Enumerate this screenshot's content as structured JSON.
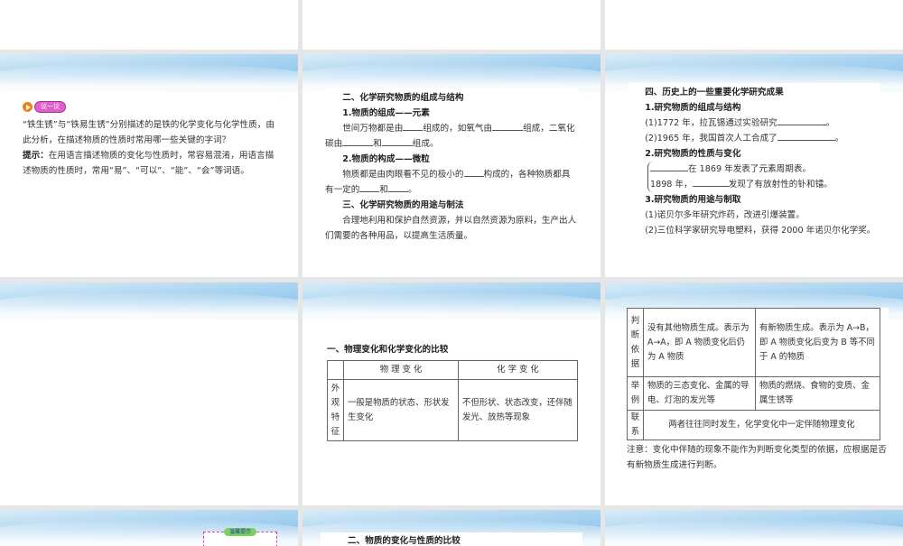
{
  "slides": {
    "s4": {
      "badge": "议一议",
      "question": "“铁生锈”与“铁易生锈”分别描述的是铁的化学变化与化学性质，由此分析，在描述物质的性质时常用哪一些关键的字词？",
      "hint_label": "提示：",
      "hint": "在用语言描述物质的变化与性质时，常容易混淆，用语言描述物质的性质时，常用“易”、“可以”、“能”、“会”等词语。"
    },
    "s5": {
      "h1": "二、化学研究物质的组成与结构",
      "h1_1": "1.物质的组成——元素",
      "p1a": "世间万物都是由",
      "p1b": "组成的，如氧气由",
      "p1c": "组成，二氧化碳由",
      "p1d": "和",
      "p1e": "组成。",
      "h1_2": "2.物质的构成——微粒",
      "p2a": "物质都是由肉眼看不见的极小的",
      "p2b": "构成的，各种物质都具有一定的",
      "p2c": "和",
      "p2d": "。",
      "h2": "三、化学研究物质的用途与制法",
      "p3": "合理地利用和保护自然资源，并以自然资源为原料，生产出人们需要的各种用品，以提高生活质量。"
    },
    "s6": {
      "h": "四、历史上的一些重要化学研究成果",
      "h1": "1.研究物质的组成与结构",
      "l1": "(1)1772 年，拉瓦锡通过实验研究",
      "l2": "(2)1965 年，我国首次人工合成了",
      "end": "。",
      "h2": "2.研究物质的性质与变化",
      "b1": "在 1869 年发表了元素周期表。",
      "b2a": "1898 年，",
      "b2b": "发现了有放射性的钋和镭。",
      "h3": "3.研究物质的用途与制取",
      "l3": "(1)诺贝尔多年研究炸药，改进引爆装置。",
      "l4": "(2)三位科学家研究导电塑料，获得 2000 年诺贝尔化学奖。"
    },
    "s8": {
      "title": "一、物理变化和化学变化的比较",
      "col1": "物 理 变 化",
      "col2": "化 学 变 化",
      "row_label": "外观特征",
      "phys": "一般是物质的状态、形状发生变化",
      "chem": "不但形状、状态改变，还伴随发光、放热等现象"
    },
    "s9": {
      "r1_label": "判断依据",
      "r1_phys": "没有其他物质生成。表示为 A→A，即 A 物质变化后仍为 A 物质",
      "r1_chem": "有新物质生成。表示为 A→B，即 A 物质变化后变为 B 等不同于 A 的物质",
      "r2_label": "举例",
      "r2_phys": "物质的三态变化、金属的导电、灯泡的发光等",
      "r2_chem": "物质的燃烧、食物的变质、金属生锈等",
      "r3_label": "联系",
      "r3": "两者往往同时发生，化学变化中一定伴随物理变化",
      "note": "注意：变化中伴随的现象不能作为判断变化类型的依据，应根据是否有新物质生成进行判断。"
    },
    "s10": {
      "tip": "温馨提示"
    },
    "s11": {
      "title": "二、物质的变化与性质的比较"
    }
  }
}
